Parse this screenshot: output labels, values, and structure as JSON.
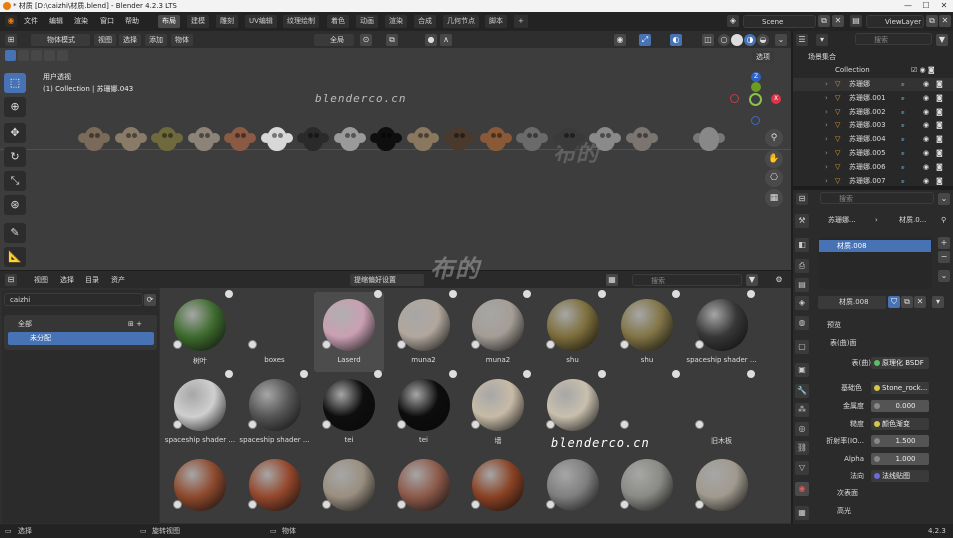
{
  "window": {
    "title": "* 材质 [D:\\caizhi\\材质.blend] - Blender 4.2.3 LTS",
    "min": "—",
    "max": "☐",
    "close": "✕"
  },
  "menu": [
    "文件",
    "编辑",
    "渲染",
    "窗口",
    "帮助"
  ],
  "workspaces": [
    "布局",
    "建模",
    "雕刻",
    "UV编辑",
    "纹理绘制",
    "着色",
    "动画",
    "渲染",
    "合成",
    "几何节点",
    "脚本",
    "+"
  ],
  "scene": "Scene",
  "viewlayer": "ViewLayer",
  "viewport": {
    "mode": "物体模式",
    "menus": [
      "视图",
      "选择",
      "添加",
      "物体"
    ],
    "transform": "全局",
    "info1": "用户透视",
    "info2": "(1) Collection | 苏珊娜.043",
    "options": "选项"
  },
  "watermark": {
    "url": "blenderco.cn",
    "logo": "布的"
  },
  "browser": {
    "menus": [
      "视图",
      "选择",
      "目录",
      "资产"
    ],
    "import": "提缩偏好设置",
    "search_ph": "搜索",
    "library": "caizhi",
    "catalog_all": "全部",
    "catalog_unassigned": "未分配"
  },
  "assets": [
    {
      "label": "树叶",
      "color": "#3e6b2e"
    },
    {
      "label": "boxes",
      "color": ""
    },
    {
      "label": "Laserd",
      "color": "#c9a0b2"
    },
    {
      "label": "muna2",
      "color": "#b1a79d"
    },
    {
      "label": "muna2",
      "color": "#a49d96"
    },
    {
      "label": "shu",
      "color": "#7d6e3b"
    },
    {
      "label": "shu",
      "color": "#817446"
    },
    {
      "label": "spaceship shader ...",
      "color": "#373737"
    },
    {
      "label": "spaceship shader ...",
      "color": "#cfcfcf"
    },
    {
      "label": "spaceship shader ...",
      "color": "#555555"
    },
    {
      "label": "tei",
      "color": "#0e0e0e"
    },
    {
      "label": "tei",
      "color": "#0c0c0c"
    },
    {
      "label": "墙",
      "color": "#c7bba7"
    },
    {
      "label": "",
      "color": "#c8bfae"
    },
    {
      "label": "",
      "color": ""
    },
    {
      "label": "旧木板",
      "color": ""
    },
    {
      "label": "",
      "color": "#8e4a2e"
    },
    {
      "label": "",
      "color": "#94482d"
    },
    {
      "label": "",
      "color": "#9a8f80"
    },
    {
      "label": "",
      "color": "#8c5a4a"
    },
    {
      "label": "",
      "color": "#8a4225"
    },
    {
      "label": "",
      "color": "#7f7f7f"
    },
    {
      "label": "",
      "color": "#8a8a85"
    },
    {
      "label": "",
      "color": "#a09a8f"
    }
  ],
  "outliner": {
    "search_ph": "搜索",
    "root": "场景集合",
    "collection": "Collection",
    "items": [
      "苏珊娜",
      "苏珊娜.001",
      "苏珊娜.002",
      "苏珊娜.003",
      "苏珊娜.004",
      "苏珊娜.005",
      "苏珊娜.006",
      "苏珊娜.007"
    ]
  },
  "properties": {
    "search_ph": "搜索",
    "breadcrumb_obj": "苏珊娜...",
    "breadcrumb_mat": "材质.0...",
    "slot": "材质.008",
    "material": "材质.008",
    "preview": "预览",
    "surface_section": "表(曲)面",
    "surface_label": "表(曲)面",
    "surface_value": "原理化 BSDF",
    "base_color_label": "基础色",
    "base_color_value": "Stone_rock...",
    "metallic_label": "金属度",
    "metallic_value": "0.000",
    "roughness_label": "糙度",
    "roughness_value": "颜色渐变",
    "ior_label": "折射率(IO...",
    "ior_value": "1.500",
    "alpha_label": "Alpha",
    "alpha_value": "1.000",
    "normal_label": "法向",
    "normal_value": "法线贴图",
    "subsurface": "次表面",
    "specular": "高光"
  },
  "statusbar": {
    "select": "选择",
    "rotate": "旋转视图",
    "object": "物体",
    "version": "4.2.3"
  }
}
